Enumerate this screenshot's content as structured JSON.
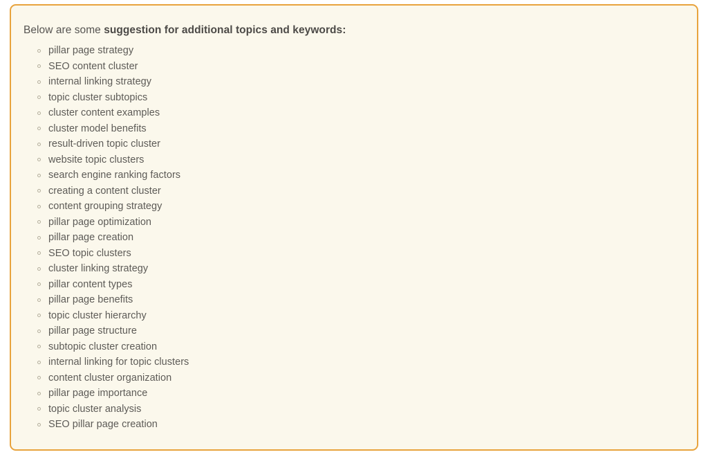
{
  "card": {
    "background_color": "#FBF8EC",
    "border_color": "#E8A33D",
    "page_background_color": "#FFFFFF"
  },
  "intro": {
    "lead_text": "Below are some ",
    "emphasis_text": "suggestion for additional topics and keywords:",
    "text_color": "#565451"
  },
  "keywords": {
    "bullet_icon": "hollow-circle-bullet",
    "bullet_color": "#b3ae9c",
    "text_color": "#5d5b57",
    "items": [
      "pillar page strategy",
      "SEO content cluster",
      "internal linking strategy",
      "topic cluster subtopics",
      "cluster content examples",
      "cluster model benefits",
      "result-driven topic cluster",
      "website topic clusters",
      "search engine ranking factors",
      "creating a content cluster",
      "content grouping strategy",
      "pillar page optimization",
      "pillar page creation",
      "SEO topic clusters",
      "cluster linking strategy",
      "pillar content types",
      "pillar page benefits",
      "topic cluster hierarchy",
      "pillar page structure",
      "subtopic cluster creation",
      "internal linking for topic clusters",
      "content cluster organization",
      "pillar page importance",
      "topic cluster analysis",
      "SEO pillar page creation"
    ]
  }
}
